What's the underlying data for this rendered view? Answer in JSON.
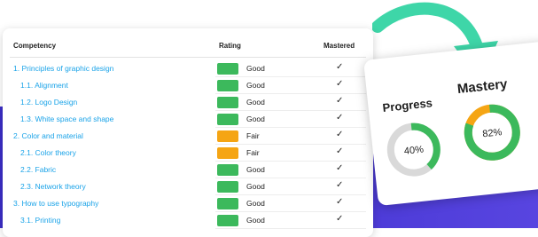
{
  "table": {
    "headers": {
      "competency": "Competency",
      "rating": "Rating",
      "mastered": "Mastered"
    },
    "rows": [
      {
        "label": "1. Principles of graphic design",
        "level": 0,
        "rating": "Good",
        "color": "#3cb95c",
        "mastered": "✓"
      },
      {
        "label": "1.1. Alignment",
        "level": 1,
        "rating": "Good",
        "color": "#3cb95c",
        "mastered": "✓"
      },
      {
        "label": "1.2. Logo Design",
        "level": 1,
        "rating": "Good",
        "color": "#3cb95c",
        "mastered": "✓"
      },
      {
        "label": "1.3. White space and shape",
        "level": 1,
        "rating": "Good",
        "color": "#3cb95c",
        "mastered": "✓"
      },
      {
        "label": "2. Color and material",
        "level": 0,
        "rating": "Fair",
        "color": "#f5a514",
        "mastered": "✓"
      },
      {
        "label": "2.1. Color theory",
        "level": 1,
        "rating": "Fair",
        "color": "#f5a514",
        "mastered": "✓"
      },
      {
        "label": "2.2. Fabric",
        "level": 1,
        "rating": "Good",
        "color": "#3cb95c",
        "mastered": "✓"
      },
      {
        "label": "2.3. Network theory",
        "level": 1,
        "rating": "Good",
        "color": "#3cb95c",
        "mastered": "✓"
      },
      {
        "label": "3. How to use typography",
        "level": 0,
        "rating": "Good",
        "color": "#3cb95c",
        "mastered": "✓"
      },
      {
        "label": "3.1. Printing",
        "level": 1,
        "rating": "Good",
        "color": "#3cb95c",
        "mastered": "✓"
      }
    ]
  },
  "stats": {
    "progress": {
      "title": "Progress",
      "value_label": "40%",
      "fraction": 0.4,
      "color": "#3cb95c",
      "track": "#d9d9d9"
    },
    "mastery": {
      "title": "Mastery",
      "value_label": "82%",
      "fraction": 0.82,
      "color": "#3cb95c",
      "remainder_color": "#f5a514"
    }
  },
  "colors": {
    "link": "#1aa3e8",
    "arrow": "#3ed6a8",
    "band": "#4a39d6"
  }
}
